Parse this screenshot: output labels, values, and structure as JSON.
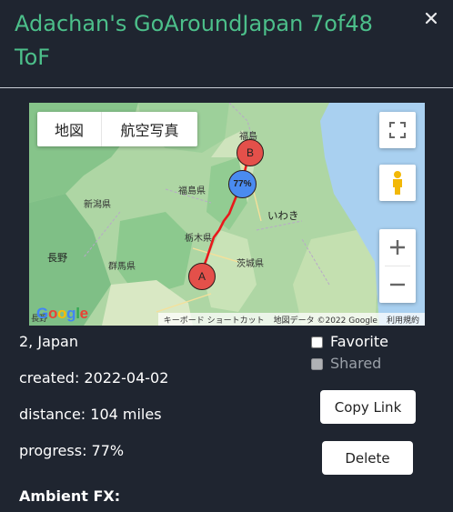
{
  "title": "Adachan's GoAroundJapan 7of48 ToF",
  "map": {
    "type_buttons": [
      "地図",
      "航空写真"
    ],
    "labels": {
      "fukushima_city": "福島",
      "fukushima_pref": "福島県",
      "niigata_pref": "新潟県",
      "iwaki": "いわき",
      "tochigi_pref": "栃木県",
      "gunma_pref": "群馬県",
      "ibaraki_pref": "茨城県",
      "nagano": "長野",
      "nagano_short": "長野"
    },
    "markers": {
      "a": "A",
      "b": "B",
      "progress": "77%"
    },
    "attribution": {
      "shortcuts": "キーボード ショートカット",
      "data": "地図データ ©2022 Google",
      "terms": "利用規約"
    },
    "logo": "Google"
  },
  "info": {
    "location": "2, Japan",
    "created": "created: 2022-04-02",
    "distance": "distance: 104 miles",
    "progress": "progress: 77%",
    "ambient": "Ambient FX:"
  },
  "options": {
    "favorite": "Favorite",
    "shared": "Shared"
  },
  "buttons": {
    "copy_link": "Copy Link",
    "delete": "Delete"
  },
  "colors": {
    "title": "#4cbf8a",
    "background": "#1f2530",
    "route": "#e8191c",
    "marker_ab": "#e4504a",
    "marker_progress": "#4a8bf0",
    "shared_text": "#9aa0a8"
  }
}
